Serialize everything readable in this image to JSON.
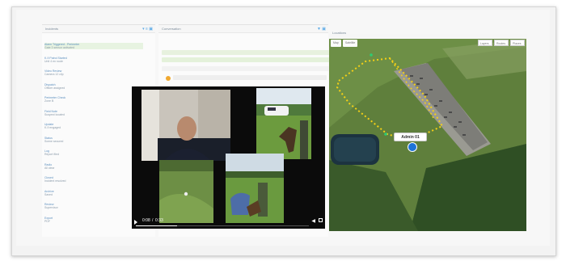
{
  "left_panel": {
    "title": "Incidents",
    "items": [
      {
        "line1": "Alarm Triggered - Perimeter",
        "line2": "Gate 3 sensor activated"
      },
      {
        "line1": "K-9 Patrol Started",
        "line2": "Unit 4 en route"
      },
      {
        "line1": "Video Review",
        "line2": "Camera 12 clip"
      },
      {
        "line1": "Dispatch",
        "line2": "Officer assigned"
      },
      {
        "line1": "Perimeter Check",
        "line2": "Zone B"
      },
      {
        "line1": "Field Note",
        "line2": "Suspect located"
      },
      {
        "line1": "Update",
        "line2": "K-9 engaged"
      },
      {
        "line1": "Status",
        "line2": "Scene secured"
      },
      {
        "line1": "Log",
        "line2": "Report filed"
      },
      {
        "line1": "Radio",
        "line2": "All clear"
      },
      {
        "line1": "Closed",
        "line2": "Incident resolved"
      },
      {
        "line1": "Archive",
        "line2": "Saved"
      },
      {
        "line1": "Review",
        "line2": "Supervisor"
      },
      {
        "line1": "Export",
        "line2": "PDF"
      }
    ]
  },
  "middle_panel": {
    "title": "Conversation",
    "messages": [
      {
        "text": "",
        "time": ""
      },
      {
        "text": "",
        "time": ""
      },
      {
        "text": "",
        "time": ""
      },
      {
        "text": "",
        "time": ""
      }
    ]
  },
  "map_panel": {
    "title": "Locations",
    "tabs": [
      "Map",
      "Satellite"
    ],
    "controls": [
      "Layers",
      "Routes",
      "Places"
    ],
    "asset_label": "Admin 01"
  },
  "video": {
    "current_time": "0:08",
    "duration": "0:33",
    "progress_fraction": 0.24
  },
  "colors": {
    "accent": "#5aa9e6",
    "track": "#f5d016",
    "asset": "#1e73d8"
  }
}
